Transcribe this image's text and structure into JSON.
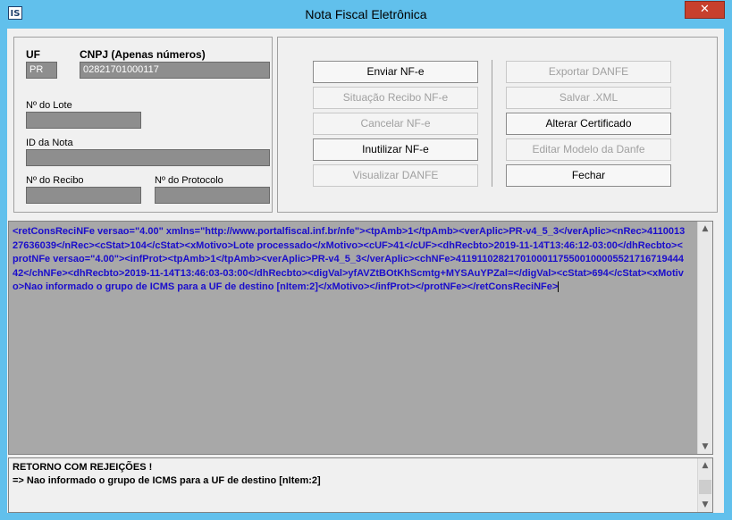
{
  "window": {
    "title": "Nota Fiscal Eletrônica",
    "close_glyph": "✕",
    "app_icon_text": "IS"
  },
  "left": {
    "uf_label": "UF",
    "uf_value": "PR",
    "cnpj_label": "CNPJ (Apenas números)",
    "cnpj_value": "02821701000117",
    "lote_label": "Nº do Lote",
    "lote_value": "",
    "id_nota_label": "ID da Nota",
    "id_nota_value": "",
    "recibo_label": "Nº do Recibo",
    "recibo_value": "",
    "protocolo_label": "Nº do Protocolo",
    "protocolo_value": ""
  },
  "buttons": {
    "enviar": "Enviar NF-e",
    "situacao": "Situação Recibo NF-e",
    "cancelar": "Cancelar NF-e",
    "inutilizar": "Inutilizar NF-e",
    "visualizar": "Visualizar DANFE",
    "exportar": "Exportar DANFE",
    "salvar": "Salvar .XML",
    "alterar": "Alterar Certificado",
    "editar": "Editar Modelo da Danfe",
    "fechar": "Fechar"
  },
  "xml_response": "<retConsReciNFe versao=\"4.00\" xmlns=\"http://www.portalfiscal.inf.br/nfe\"><tpAmb>1</tpAmb><verAplic>PR-v4_5_3</verAplic><nRec>411001327636039</nRec><cStat>104</cStat><xMotivo>Lote processado</xMotivo><cUF>41</cUF><dhRecbto>2019-11-14T13:46:12-03:00</dhRecbto><protNFe versao=\"4.00\"><infProt><tpAmb>1</tpAmb><verAplic>PR-v4_5_3</verAplic><chNFe>41191102821701000117550010000552171671944442</chNFe><dhRecbto>2019-11-14T13:46:03-03:00</dhRecbto><digVal>yfAVZtBOtKhScmtg+MYSAuYPZal=</digVal><cStat>694</cStat><xMotivo>Nao informado o grupo de ICMS para a UF de destino [nItem:2]</xMotivo></infProt></protNFe></retConsReciNFe>",
  "retorno": {
    "line1": "RETORNO COM REJEIÇÕES !",
    "line2": "=> Nao informado o grupo de ICMS para a UF de destino [nItem:2]"
  },
  "scroll": {
    "up_glyph": "▲",
    "down_glyph": "▼"
  }
}
